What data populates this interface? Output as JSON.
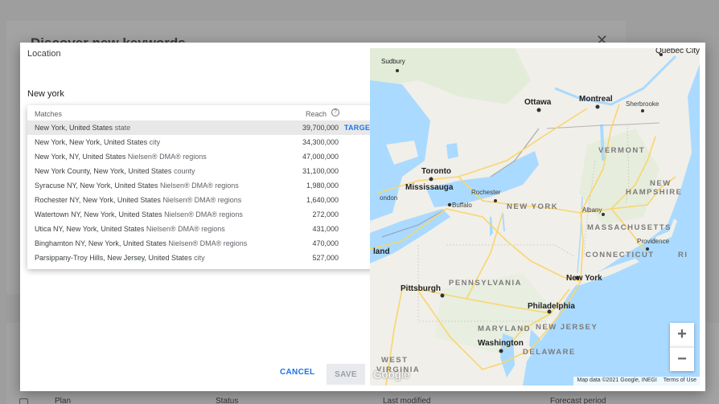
{
  "background": {
    "dialog_title": "Discover new keywords",
    "close_icon": "close-icon",
    "table_columns": [
      "Plan",
      "Status",
      "Last modified",
      "Forecast period"
    ]
  },
  "location": {
    "label": "Location",
    "input_value": "New york"
  },
  "dropdown": {
    "header_matches": "Matches",
    "header_reach": "Reach",
    "help_icon": "?",
    "target_label": "TARGET",
    "rows": [
      {
        "name": "New York, United States",
        "type": "state",
        "reach": "39,700,000"
      },
      {
        "name": "New York, New York, United States",
        "type": "city",
        "reach": "34,300,000"
      },
      {
        "name": "New York, NY, United States",
        "type": "Nielsen® DMA® regions",
        "reach": "47,000,000"
      },
      {
        "name": "New York County, New York, United States",
        "type": "county",
        "reach": "31,100,000"
      },
      {
        "name": "Syracuse NY, New York, United States",
        "type": "Nielsen® DMA® regions",
        "reach": "1,980,000"
      },
      {
        "name": "Rochester NY, New York, United States",
        "type": "Nielsen® DMA® regions",
        "reach": "1,640,000"
      },
      {
        "name": "Watertown NY, New York, United States",
        "type": "Nielsen® DMA® regions",
        "reach": "272,000"
      },
      {
        "name": "Utica NY, New York, United States",
        "type": "Nielsen® DMA® regions",
        "reach": "431,000"
      },
      {
        "name": "Binghamton NY, New York, United States",
        "type": "Nielsen® DMA® regions",
        "reach": "470,000"
      },
      {
        "name": "Parsippany-Troy Hills, New Jersey, United States",
        "type": "city",
        "reach": "527,000"
      }
    ]
  },
  "actions": {
    "cancel": "CANCEL",
    "save": "SAVE"
  },
  "map": {
    "labels": {
      "quebec": "Québec City",
      "sudbury": "Sudbury",
      "ottawa": "Ottawa",
      "montreal": "Montreal",
      "sherbrooke": "Sherbrooke",
      "vermont": "VERMONT",
      "toronto": "Toronto",
      "mississauga": "Mississauga",
      "rochester": "Rochester",
      "buffalo": "Buffalo",
      "london": "ondon",
      "new_york_state": "NEW YORK",
      "albany": "Albany",
      "new_hampshire_1": "NEW",
      "new_hampshire_2": "HAMPSHIRE",
      "massachusetts": "MASSACHUSETTS",
      "providence": "Providence",
      "connecticut": "CONNECTICUT",
      "ri": "RI",
      "land": "land",
      "pittsburgh": "Pittsburgh",
      "pennsylvania": "PENNSYLVANIA",
      "new_york_city": "New York",
      "philadelphia": "Philadelphia",
      "maryland": "MARYLAND",
      "new_jersey": "NEW JERSEY",
      "washington": "Washington",
      "delaware": "DELAWARE",
      "west_virginia_1": "WEST",
      "west_virginia_2": "VIRGINIA"
    },
    "zoom_in": "+",
    "zoom_out": "−",
    "logo": "Google",
    "attribution": "Map data ©2021 Google, INEGI",
    "terms": "Terms of Use"
  }
}
